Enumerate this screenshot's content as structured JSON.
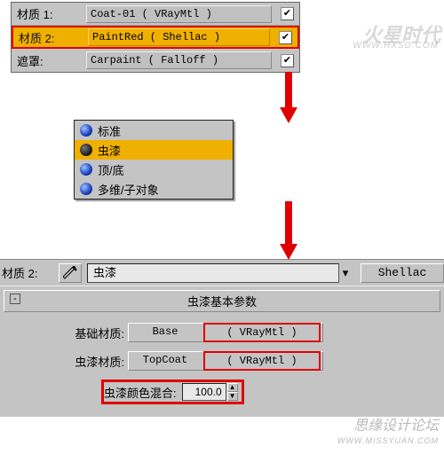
{
  "top": {
    "rows": [
      {
        "label": "材质 1:",
        "text": "Coat-01   ( VRayMtl )"
      },
      {
        "label": "材质 2:",
        "text": "PaintRed  ( Shellac )"
      },
      {
        "label": "遮罩:",
        "text": "Carpaint  ( Falloff )"
      }
    ],
    "check": "✔"
  },
  "menu": {
    "items": [
      "标准",
      "虫漆",
      "顶/底",
      "多维/子对象"
    ]
  },
  "bar": {
    "label": "材质 2:",
    "name": "虫漆",
    "type": "Shellac"
  },
  "panel": {
    "title": "虫漆基本参数",
    "rows": [
      {
        "label": "基础材质:",
        "name": "Base",
        "type": "( VRayMtl )"
      },
      {
        "label": "虫漆材质:",
        "name": "TopCoat",
        "type": "( VRayMtl )"
      }
    ],
    "mix_label": "虫漆颜色混合:",
    "mix_value": "100.0"
  },
  "wm": {
    "a": "火星时代",
    "a_sub": "WWW.HXSD.COM",
    "b": "思缘设计论坛",
    "b_sub": "WWW.MISSYUAN.COM"
  }
}
